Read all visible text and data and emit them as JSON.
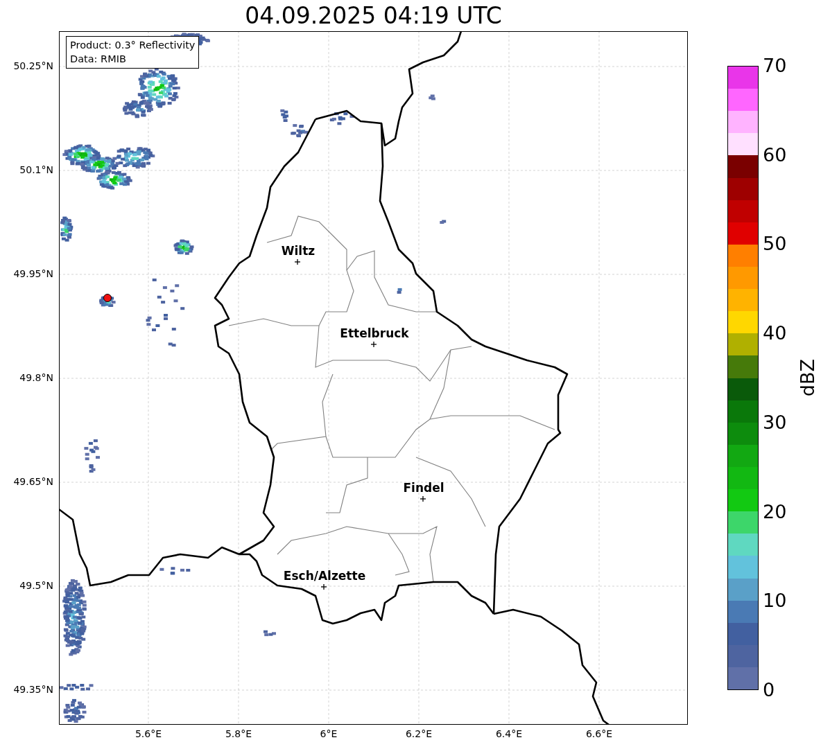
{
  "title": "04.09.2025 04:19 UTC",
  "map": {
    "info": [
      "Product: 0.3° Reflectivity",
      "Data: RMIB"
    ],
    "lat_ticks": [
      "50.25°N",
      "50.1°N",
      "49.95°N",
      "49.8°N",
      "49.65°N",
      "49.5°N",
      "49.35°N"
    ],
    "lon_ticks": [
      "5.6°E",
      "5.8°E",
      "6°E",
      "6.2°E",
      "6.4°E",
      "6.6°E"
    ],
    "places": [
      {
        "name": "Wiltz"
      },
      {
        "name": "Ettelbruck"
      },
      {
        "name": "Findel"
      },
      {
        "name": "Esch/Alzette"
      }
    ]
  },
  "colorbar": {
    "label": "dBZ",
    "ticks": [
      "70",
      "60",
      "50",
      "40",
      "30",
      "20",
      "10",
      "0"
    ],
    "bands": [
      {
        "color": "#e935e9"
      },
      {
        "color": "#ff66ff"
      },
      {
        "color": "#ffb3ff"
      },
      {
        "color": "#ffe0ff"
      },
      {
        "color": "#7a0000"
      },
      {
        "color": "#9e0000"
      },
      {
        "color": "#c00000"
      },
      {
        "color": "#e00000"
      },
      {
        "color": "#ff7f00"
      },
      {
        "color": "#ff9900"
      },
      {
        "color": "#ffb300"
      },
      {
        "color": "#ffd700"
      },
      {
        "color": "#b0b000"
      },
      {
        "color": "#467a0a"
      },
      {
        "color": "#0a5a0a"
      },
      {
        "color": "#0a780a"
      },
      {
        "color": "#0d8c0d"
      },
      {
        "color": "#12a812"
      },
      {
        "color": "#12b812"
      },
      {
        "color": "#12c912"
      },
      {
        "color": "#3dd66a"
      },
      {
        "color": "#5fd8c0"
      },
      {
        "color": "#62c2dc"
      },
      {
        "color": "#5aa0c8"
      },
      {
        "color": "#4a7ab4"
      },
      {
        "color": "#4260a0"
      },
      {
        "color": "#4e64a0"
      },
      {
        "color": "#6070a8"
      }
    ]
  }
}
